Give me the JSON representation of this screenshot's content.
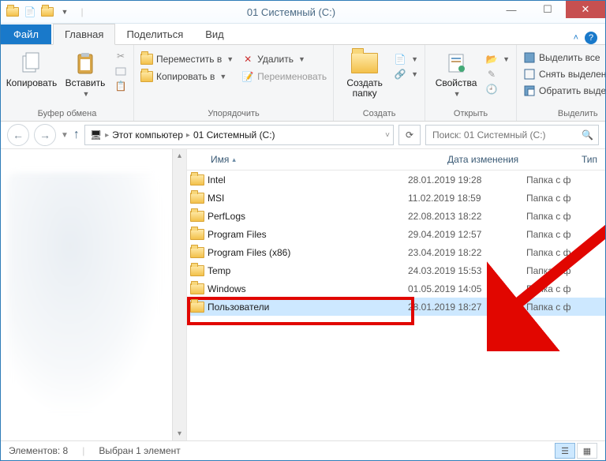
{
  "window": {
    "title": "01 Системный (C:)"
  },
  "tabs": {
    "file": "Файл",
    "home": "Главная",
    "share": "Поделиться",
    "view": "Вид"
  },
  "ribbon": {
    "clipboard": {
      "copy": "Копировать",
      "paste": "Вставить",
      "label": "Буфер обмена"
    },
    "organize": {
      "moveTo": "Переместить в",
      "copyTo": "Копировать в",
      "delete": "Удалить",
      "rename": "Переименовать",
      "label": "Упорядочить"
    },
    "new": {
      "newFolder": "Создать\nпапку",
      "label": "Создать"
    },
    "open": {
      "properties": "Свойства",
      "label": "Открыть"
    },
    "select": {
      "selectAll": "Выделить все",
      "selectNone": "Снять выделение",
      "invert": "Обратить выделение",
      "label": "Выделить"
    }
  },
  "breadcrumb": {
    "thisPC": "Этот компьютер",
    "drive": "01 Системный (C:)"
  },
  "search": {
    "placeholder": "Поиск: 01 Системный (C:)"
  },
  "columns": {
    "name": "Имя",
    "date": "Дата изменения",
    "type": "Тип"
  },
  "files": [
    {
      "name": "Intel",
      "date": "28.01.2019 19:28",
      "type": "Папка с ф"
    },
    {
      "name": "MSI",
      "date": "11.02.2019 18:59",
      "type": "Папка с ф"
    },
    {
      "name": "PerfLogs",
      "date": "22.08.2013 18:22",
      "type": "Папка с ф"
    },
    {
      "name": "Program Files",
      "date": "29.04.2019 12:57",
      "type": "Папка с ф"
    },
    {
      "name": "Program Files (x86)",
      "date": "23.04.2019 18:22",
      "type": "Папка с ф"
    },
    {
      "name": "Temp",
      "date": "24.03.2019 15:53",
      "type": "Папка с ф"
    },
    {
      "name": "Windows",
      "date": "01.05.2019 14:05",
      "type": "Папка с ф"
    },
    {
      "name": "Пользователи",
      "date": "28.01.2019 18:27",
      "type": "Папка с ф"
    }
  ],
  "selectedIndex": 7,
  "status": {
    "items": "Элементов: 8",
    "selected": "Выбран 1 элемент"
  }
}
